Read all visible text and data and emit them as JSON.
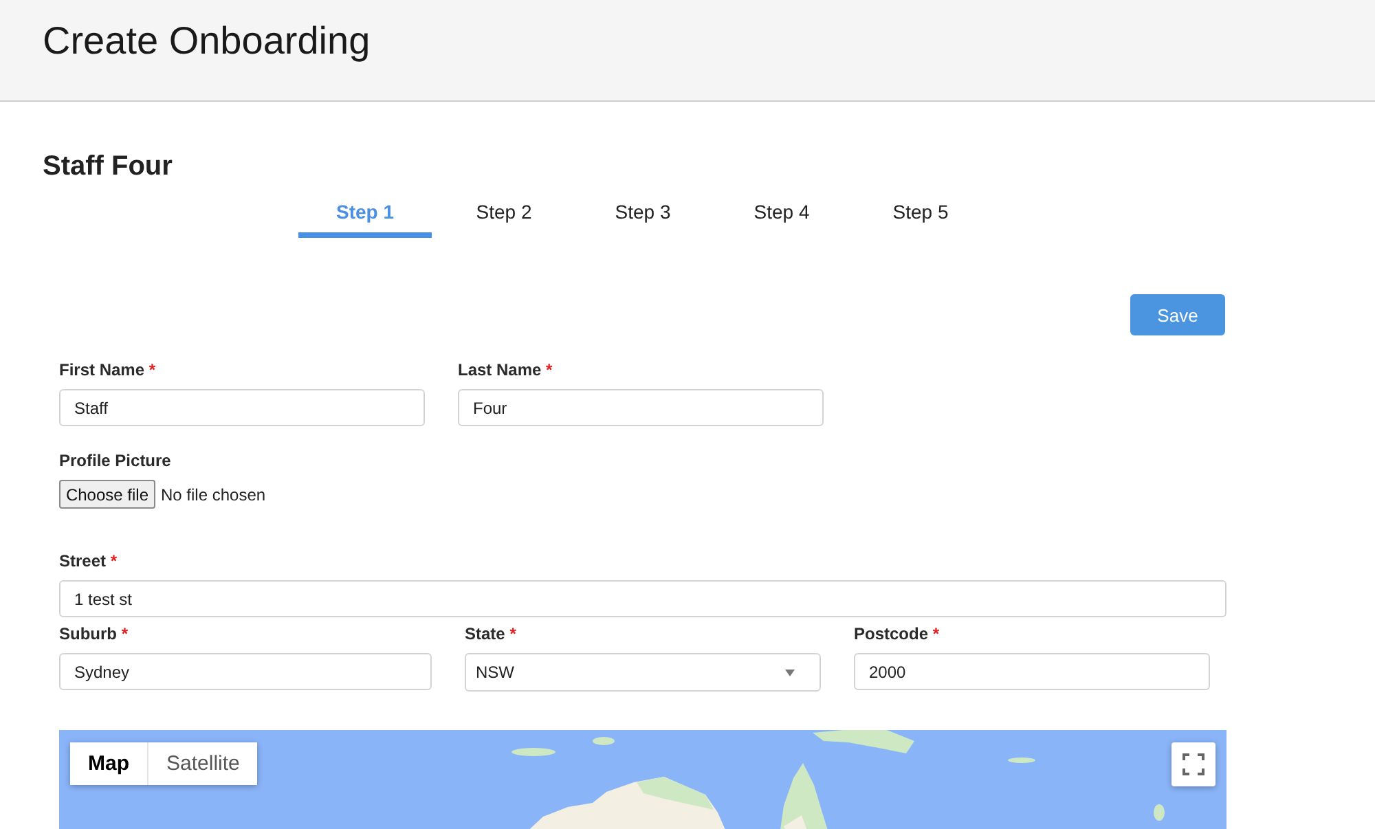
{
  "header": {
    "title": "Create Onboarding"
  },
  "staff_name": "Staff Four",
  "tabs": [
    {
      "label": "Step 1",
      "selected": true
    },
    {
      "label": "Step 2",
      "selected": false
    },
    {
      "label": "Step 3",
      "selected": false
    },
    {
      "label": "Step 4",
      "selected": false
    },
    {
      "label": "Step 5",
      "selected": false
    }
  ],
  "save_button": "Save",
  "sections": [
    {
      "rows": [
        [
          {
            "kind": "text",
            "label": "First Name",
            "required_mark": "*",
            "value": "Staff"
          },
          {
            "kind": "text",
            "label": "Last Name",
            "required_mark": "*",
            "value": "Four"
          }
        ],
        [
          {
            "kind": "file",
            "label": "Profile Picture",
            "button": "Choose file",
            "status": "No file chosen"
          }
        ]
      ]
    },
    {
      "rows": [
        [
          {
            "kind": "text",
            "label": "Street",
            "required_mark": "*",
            "value": "1 test st"
          }
        ],
        [
          {
            "kind": "text",
            "label": "Suburb",
            "required_mark": "*",
            "value": "Sydney"
          },
          {
            "kind": "select",
            "label": "State",
            "required_mark": "*",
            "value": "NSW"
          },
          {
            "kind": "text",
            "label": "Postcode",
            "required_mark": "*",
            "value": "2000"
          }
        ]
      ]
    }
  ],
  "map": {
    "types": [
      {
        "label": "Map",
        "selected": true
      },
      {
        "label": "Satellite",
        "selected": false
      }
    ]
  }
}
